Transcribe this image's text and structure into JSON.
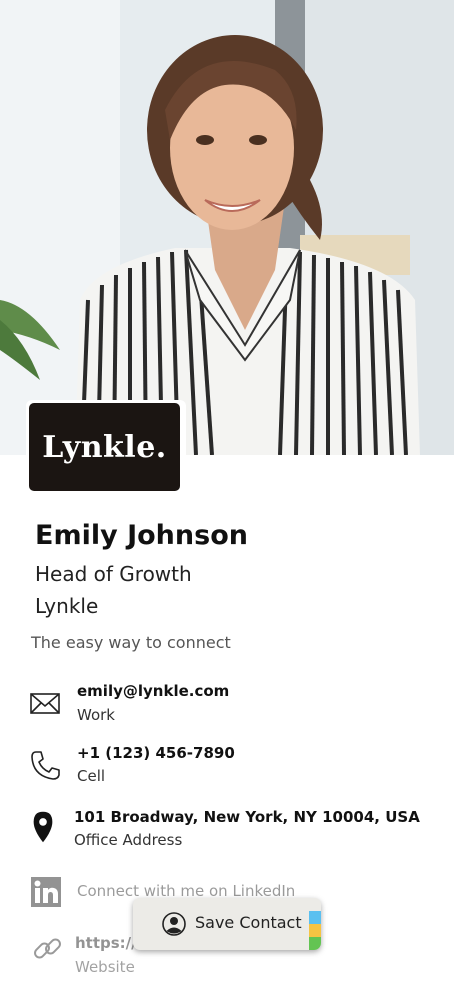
{
  "profile": {
    "photo_alt": "",
    "logo_text": "Lynkle.",
    "name": "Emily Johnson",
    "title": "Head of Growth",
    "company": "Lynkle",
    "tagline": "The easy way to connect"
  },
  "contacts": {
    "email": {
      "value": "emily@lynkle.com",
      "label": "Work",
      "icon": "mail-icon"
    },
    "phone": {
      "value": "+1 (123) 456-7890",
      "label": "Cell",
      "icon": "phone-icon"
    },
    "address": {
      "value": "101 Broadway, New York, NY 10004, USA",
      "label": "Office Address",
      "icon": "location-pin-icon"
    },
    "linkedin": {
      "value": "Connect with me on LinkedIn",
      "icon": "linkedin-icon"
    },
    "website": {
      "value": "https://l",
      "label": "Website",
      "icon": "link-icon"
    }
  },
  "actions": {
    "save_contact_label": "Save Contact",
    "save_contact_icon": "user-circle-icon",
    "accent_colors": [
      "#5bc0f0",
      "#f6c443",
      "#63c452"
    ]
  }
}
